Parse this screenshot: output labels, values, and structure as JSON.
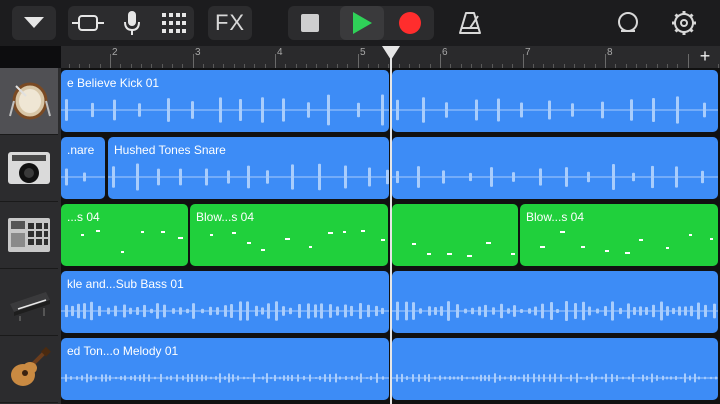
{
  "toolbar": {
    "fx_label": "FX"
  },
  "ruler": {
    "bars": [
      "2",
      "3",
      "4",
      "5",
      "6",
      "7",
      "8"
    ],
    "add_label": "+"
  },
  "tracks": [
    {
      "name": "drums",
      "icon": "drum-kit-icon",
      "regions": [
        {
          "label": "e Believe Kick 01",
          "color": "blue"
        }
      ]
    },
    {
      "name": "beat-sequencer",
      "icon": "boombox-icon",
      "regions": [
        {
          "label": ".nare",
          "color": "blue"
        },
        {
          "label": "Hushed Tones Snare",
          "color": "blue"
        }
      ]
    },
    {
      "name": "drum-machine",
      "icon": "drum-pad-icon",
      "regions": [
        {
          "label": "...s 04",
          "color": "green"
        },
        {
          "label": "Blow...s 04",
          "color": "green"
        },
        {
          "label": "",
          "color": "green"
        },
        {
          "label": "",
          "color": "green"
        },
        {
          "label": "Blow...s 04",
          "color": "green"
        }
      ]
    },
    {
      "name": "synth-bass",
      "icon": "keyboard-icon",
      "regions": [
        {
          "label": "kle and...Sub Bass 01",
          "color": "blue"
        }
      ]
    },
    {
      "name": "guitar",
      "icon": "guitar-icon",
      "regions": [
        {
          "label": "ed Ton...o Melody 01",
          "color": "blue"
        }
      ]
    }
  ],
  "colors": {
    "audio_region": "#3d8cf6",
    "midi_region": "#20d03c",
    "record": "#ff2d2d",
    "play": "#2fd158"
  }
}
